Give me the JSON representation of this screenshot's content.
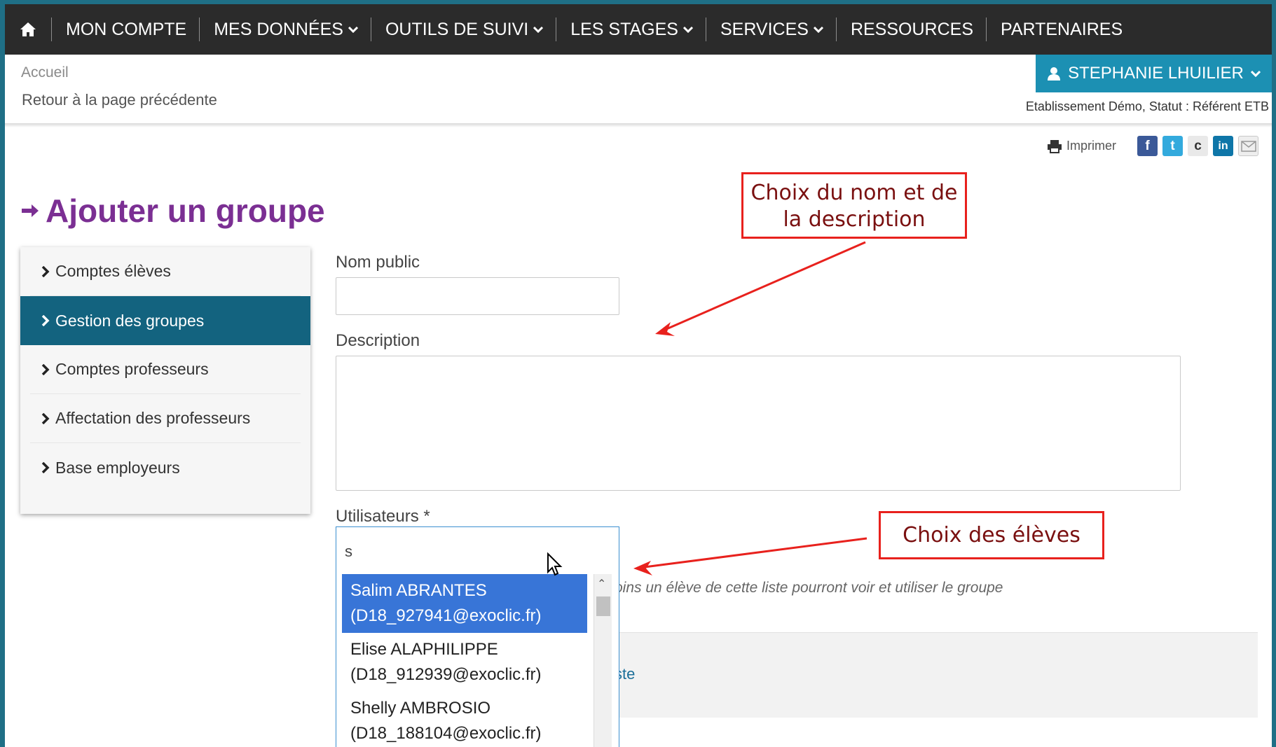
{
  "nav": {
    "items": [
      {
        "label": "MON COMPTE",
        "dropdown": false
      },
      {
        "label": "MES DONNÉES",
        "dropdown": true
      },
      {
        "label": "OUTILS DE SUIVI",
        "dropdown": true
      },
      {
        "label": "LES STAGES",
        "dropdown": true
      },
      {
        "label": "SERVICES",
        "dropdown": true
      },
      {
        "label": "RESSOURCES",
        "dropdown": false
      },
      {
        "label": "PARTENAIRES",
        "dropdown": false
      }
    ]
  },
  "header": {
    "breadcrumb": "Accueil",
    "back_link": "Retour à la page précédente",
    "user_name": "STEPHANIE LHUILIER",
    "status_line": "Etablissement Démo, Statut : Référent ETB"
  },
  "share": {
    "print_label": "Imprimer",
    "icons": [
      "facebook-icon",
      "twitter-icon",
      "reddit-icon",
      "linkedin-icon",
      "email-icon"
    ]
  },
  "page": {
    "title": "Ajouter un groupe"
  },
  "sidebar": {
    "items": [
      {
        "label": "Comptes élèves",
        "active": false
      },
      {
        "label": "Gestion des groupes",
        "active": true
      },
      {
        "label": "Comptes professeurs",
        "active": false
      },
      {
        "label": "Affectation des professeurs",
        "active": false
      },
      {
        "label": "Base employeurs",
        "active": false
      }
    ]
  },
  "form": {
    "name_label": "Nom public",
    "name_value": "",
    "description_label": "Description",
    "description_value": "",
    "users_label": "Utilisateurs *",
    "users_typed": "s",
    "help_text": "oins un élève de cette liste pourront voir et utiliser le groupe",
    "panel_link_fragment": "ste",
    "options": [
      {
        "name": "Salim ABRANTES",
        "email": "(D18_927941@exoclic.fr)",
        "highlighted": true
      },
      {
        "name": "Elise ALAPHILIPPE",
        "email": "(D18_912939@exoclic.fr)",
        "highlighted": false
      },
      {
        "name": "Shelly AMBROSIO",
        "email": "(D18_188104@exoclic.fr)",
        "highlighted": false
      }
    ]
  },
  "annotations": {
    "name_desc": "Choix du nom et de la description",
    "students": "Choix des élèves"
  },
  "colors": {
    "nav_bg": "#2b2b2b",
    "accent": "#1c90b3",
    "active_sidebar": "#13637f",
    "title": "#7b2f93",
    "highlight": "#3875d7",
    "callout_border": "#e8211d"
  }
}
